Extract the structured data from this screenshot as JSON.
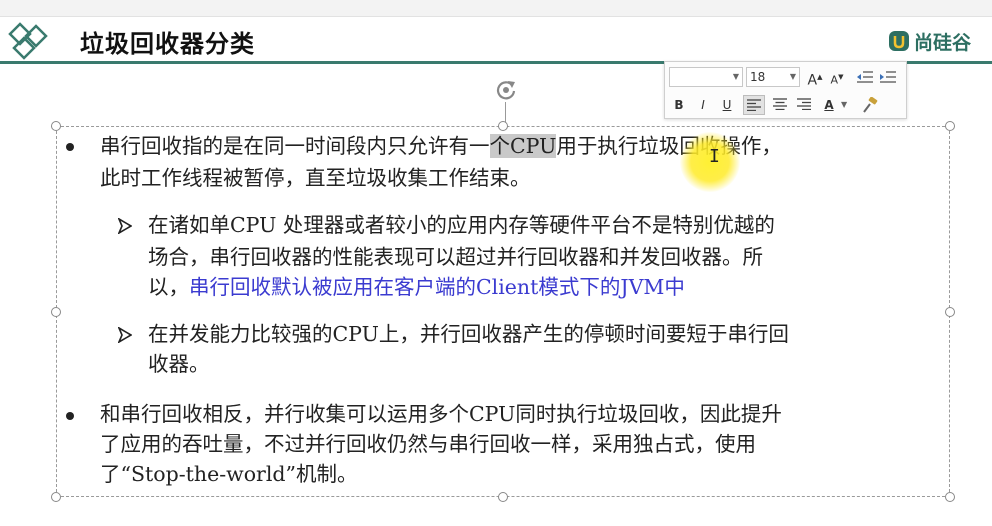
{
  "slide": {
    "title": "垃圾回收器分类",
    "brand": "尚硅谷"
  },
  "toolbar": {
    "font_name": "",
    "font_size": "18",
    "grow_font": "A",
    "shrink_font": "A",
    "bold": "B",
    "italic": "I",
    "underline": "U",
    "font_color": "A"
  },
  "content": {
    "b1_l1_pre": "串行回收指的是在同一时间段内只允许有一",
    "b1_l1_hl": "个CPU",
    "b1_l1_post": "用于执行垃圾回收操作，",
    "b1_l2": "此时工作线程被暂停，直至垃圾收集工作结束。",
    "s1_l1": "在诸如单CPU 处理器或者较小的应用内存等硬件平台不是特别优越的",
    "s1_l2": "场合，串行回收器的性能表现可以超过并行回收器和并发回收器。所",
    "s1_l3_pre": "以，",
    "s1_l3_blue": "串行回收默认被应用在客户端的Client模式下的JVM中",
    "s2_l1": "在并发能力比较强的CPU上，并行回收器产生的停顿时间要短于串行回",
    "s2_l2": "收器。",
    "b2_l1": "和串行回收相反，并行收集可以运用多个CPU同时执行垃圾回收，因此提升",
    "b2_l2": "了应用的吞吐量，不过并行回收仍然与串行回收一样，采用独占式，使用",
    "b2_l3": "了“Stop-the-world”机制。"
  },
  "colors": {
    "accent": "#3a7a6e",
    "link_blue": "#3b3bd0",
    "highlight": "#c9c9c9",
    "cursor_spot": "#ffeb28"
  }
}
